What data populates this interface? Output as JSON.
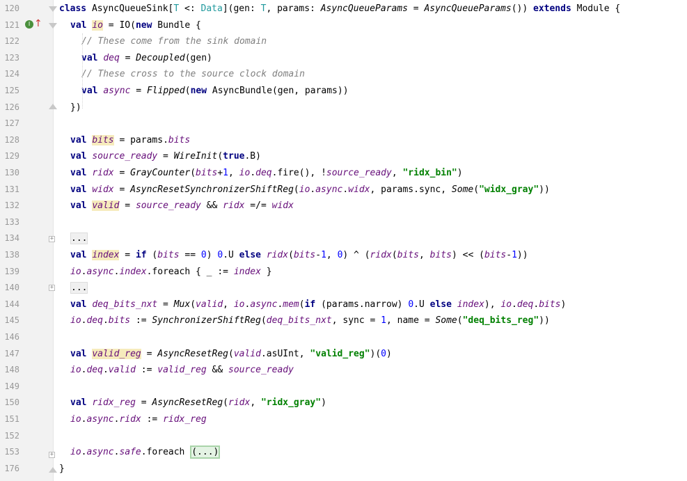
{
  "editor": {
    "lines": [
      {
        "no": "120",
        "code": "class AsyncQueueSink[T <: Data](gen: T, params: AsyncQueueParams = AsyncQueueParams()) extends Module {"
      },
      {
        "no": "121",
        "code": "val io = IO(new Bundle {"
      },
      {
        "no": "122",
        "code": "// These come from the sink domain"
      },
      {
        "no": "123",
        "code": "val deq = Decoupled(gen)"
      },
      {
        "no": "124",
        "code": "// These cross to the source clock domain"
      },
      {
        "no": "125",
        "code": "val async = Flipped(new AsyncBundle(gen, params))"
      },
      {
        "no": "126",
        "code": "})"
      },
      {
        "no": "127",
        "code": ""
      },
      {
        "no": "128",
        "code": "val bits = params.bits"
      },
      {
        "no": "129",
        "code": "val source_ready = WireInit(true.B)"
      },
      {
        "no": "130",
        "code": "val ridx = GrayCounter(bits+1, io.deq.fire(), !source_ready, \"ridx_bin\")"
      },
      {
        "no": "131",
        "code": "val widx = AsyncResetSynchronizerShiftReg(io.async.widx, params.sync, Some(\"widx_gray\"))"
      },
      {
        "no": "132",
        "code": "val valid = source_ready && ridx =/= widx"
      },
      {
        "no": "133",
        "code": ""
      },
      {
        "no": "134",
        "code": "..."
      },
      {
        "no": "138",
        "code": "val index = if (bits == 0) 0.U else ridx(bits-1, 0) ^ (ridx(bits, bits) << (bits-1))"
      },
      {
        "no": "139",
        "code": "io.async.index.foreach { _ := index }"
      },
      {
        "no": "140",
        "code": "..."
      },
      {
        "no": "144",
        "code": "val deq_bits_nxt = Mux(valid, io.async.mem(if (params.narrow) 0.U else index), io.deq.bits)"
      },
      {
        "no": "145",
        "code": "io.deq.bits := SynchronizerShiftReg(deq_bits_nxt, sync = 1, name = Some(\"deq_bits_reg\"))"
      },
      {
        "no": "146",
        "code": ""
      },
      {
        "no": "147",
        "code": "val valid_reg = AsyncResetReg(valid.asUInt, \"valid_reg\")(0)"
      },
      {
        "no": "148",
        "code": "io.deq.valid := valid_reg && source_ready"
      },
      {
        "no": "149",
        "code": ""
      },
      {
        "no": "150",
        "code": "val ridx_reg = AsyncResetReg(ridx, \"ridx_gray\")"
      },
      {
        "no": "151",
        "code": "io.async.ridx := ridx_reg"
      },
      {
        "no": "152",
        "code": ""
      },
      {
        "no": "153",
        "code": "io.async.safe.foreach (...)"
      },
      {
        "no": "176",
        "code": "}"
      }
    ],
    "gutter_badge": "I",
    "gutter_arrow": "↑",
    "fold_placeholder": "(...)"
  },
  "colors": {
    "keyword": "#000080",
    "type": "#20999d",
    "field": "#660e7a",
    "number": "#0000ff",
    "string": "#008000",
    "comment": "#808080",
    "highlight": "#f6ebbc"
  }
}
